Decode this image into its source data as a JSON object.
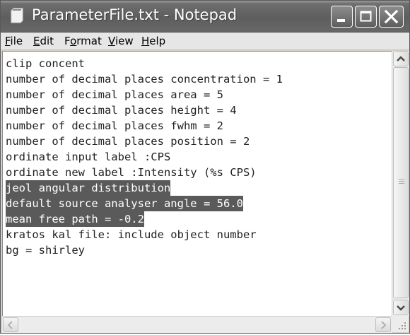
{
  "window": {
    "title": "ParameterFile.txt - Notepad"
  },
  "menu": [
    {
      "before": "",
      "accel": "F",
      "after": "ile"
    },
    {
      "before": "",
      "accel": "E",
      "after": "dit"
    },
    {
      "before": "F",
      "accel": "o",
      "after": "rmat"
    },
    {
      "before": "",
      "accel": "V",
      "after": "iew"
    },
    {
      "before": "",
      "accel": "H",
      "after": "elp"
    }
  ],
  "editor": {
    "lines": [
      "clip concent",
      "number of decimal places concentration = 1",
      "number of decimal places area = 5",
      "number of decimal places height = 4",
      "number of decimal places fwhm = 2",
      "number of decimal places position = 2",
      "ordinate input label :CPS",
      "ordinate new label :Intensity (%s CPS)",
      "jeol angular distribution",
      "default source analyser angle = 56.0",
      "mean free path = -0.2",
      "kratos kal file: include object number",
      "bg = shirley"
    ],
    "selected_lines": [
      8,
      9,
      10
    ]
  },
  "colors": {
    "selection": "#5a5a5a",
    "titlebar": "#6e6e6e"
  },
  "icons": [
    "notepad-icon",
    "minimize-icon",
    "maximize-icon",
    "close-icon",
    "scroll-up-arrow-icon",
    "scroll-down-arrow-icon",
    "scroll-left-arrow-icon",
    "scroll-right-arrow-icon",
    "resize-grip-icon"
  ]
}
